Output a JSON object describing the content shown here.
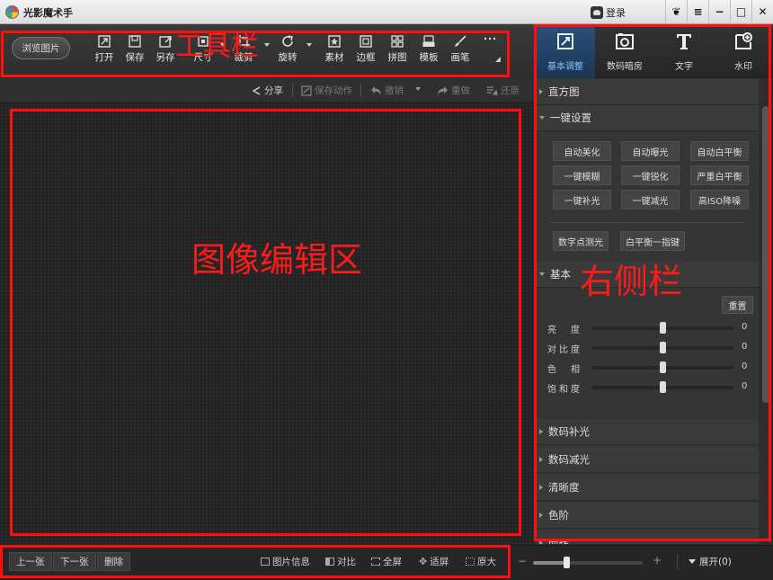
{
  "app": {
    "title": "光影魔术手"
  },
  "titlebar": {
    "login_label": "登录",
    "window_buttons": [
      {
        "name": "skin-button",
        "glyph": "❦"
      },
      {
        "name": "menu-button",
        "glyph": "≡"
      },
      {
        "name": "minimize-button",
        "glyph": "−"
      },
      {
        "name": "maximize-button",
        "glyph": "□"
      },
      {
        "name": "close-button",
        "glyph": "✕"
      }
    ]
  },
  "toolbar": {
    "browse_label": "浏览图片",
    "tools": [
      {
        "name": "open",
        "label": "打开",
        "icon": "open-icon"
      },
      {
        "name": "save",
        "label": "保存",
        "icon": "save-icon"
      },
      {
        "name": "save-as",
        "label": "另存",
        "icon": "save-as-icon"
      },
      {
        "name": "size",
        "label": "尺寸",
        "icon": "resize-icon"
      },
      {
        "name": "crop",
        "label": "裁剪",
        "icon": "crop-icon"
      },
      {
        "name": "rotate",
        "label": "旋转",
        "icon": "rotate-icon"
      },
      {
        "name": "material",
        "label": "素材",
        "icon": "material-icon"
      },
      {
        "name": "border",
        "label": "边框",
        "icon": "border-icon"
      },
      {
        "name": "collage",
        "label": "拼图",
        "icon": "collage-icon"
      },
      {
        "name": "template",
        "label": "模板",
        "icon": "template-icon"
      },
      {
        "name": "brush",
        "label": "画笔",
        "icon": "brush-icon"
      },
      {
        "name": "more",
        "label": "",
        "icon": "more-icon"
      }
    ]
  },
  "subbar": {
    "share": "分享",
    "save_action": "保存动作",
    "undo": "撤销",
    "redo": "重做",
    "restore": "还原"
  },
  "bottombar": {
    "prev": "上一张",
    "next": "下一张",
    "delete": "删除",
    "image_info": "图片信息",
    "compare": "对比",
    "fullscreen": "全屏",
    "fit_screen": "适屏",
    "original_size": "原大",
    "zoom_level": 0.3,
    "expand": "展开(0)"
  },
  "rpanel": {
    "tabs": [
      {
        "name": "basic-adjust",
        "label": "基本调整",
        "icon": "adjust-icon",
        "active": true
      },
      {
        "name": "digital-darkroom",
        "label": "数码暗房",
        "icon": "darkroom-icon",
        "active": false
      },
      {
        "name": "text",
        "label": "文字",
        "icon": "text-icon",
        "active": false
      },
      {
        "name": "watermark",
        "label": "水印",
        "icon": "watermark-icon",
        "active": false
      }
    ],
    "sections": {
      "histogram": "直方图",
      "one_click": "一键设置",
      "basic": "基本",
      "digital_fill": "数码补光",
      "digital_reduce": "数码减光",
      "sharpness": "清晰度",
      "levels": "色阶",
      "curves": "曲线"
    },
    "one_click_buttons": [
      "自动美化",
      "自动曝光",
      "自动白平衡",
      "一键模糊",
      "一键锐化",
      "严重白平衡",
      "一键补光",
      "一键减光",
      "高ISO降噪"
    ],
    "extra_buttons": [
      "数字点测光",
      "白平衡一指键"
    ],
    "basic": {
      "reset": "重置",
      "sliders": [
        {
          "name": "brightness",
          "label": "亮　度",
          "value": "0",
          "level": 0.5
        },
        {
          "name": "contrast",
          "label": "对比度",
          "value": "0",
          "level": 0.5
        },
        {
          "name": "hue",
          "label": "色　相",
          "value": "0",
          "level": 0.5
        },
        {
          "name": "saturation",
          "label": "饱和度",
          "value": "0",
          "level": 0.5
        }
      ]
    }
  },
  "annotations": {
    "toolbar": "工具栏",
    "editor": "图像编辑区",
    "sidebar": "右侧栏",
    "color": "#ff1010"
  }
}
